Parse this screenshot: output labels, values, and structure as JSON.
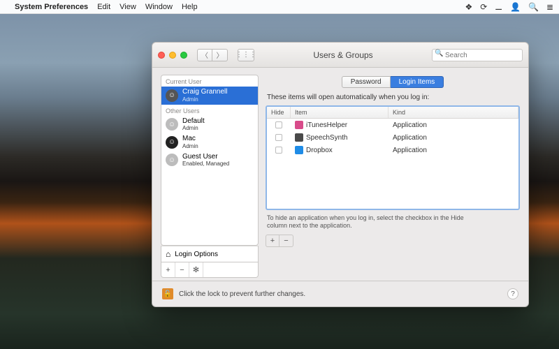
{
  "menubar": {
    "app": "System Preferences",
    "items": [
      "Edit",
      "View",
      "Window",
      "Help"
    ]
  },
  "window": {
    "title": "Users & Groups",
    "search_placeholder": "Search"
  },
  "sidebar": {
    "current_header": "Current User",
    "other_header": "Other Users",
    "current": {
      "name": "Craig Grannell",
      "role": "Admin"
    },
    "others": [
      {
        "name": "Default",
        "role": "Admin"
      },
      {
        "name": "Mac",
        "role": "Admin"
      },
      {
        "name": "Guest User",
        "role": "Enabled, Managed"
      }
    ],
    "login_options": "Login Options"
  },
  "tabs": {
    "password": "Password",
    "login_items": "Login Items"
  },
  "login_items": {
    "description": "These items will open automatically when you log in:",
    "columns": {
      "hide": "Hide",
      "item": "Item",
      "kind": "Kind"
    },
    "rows": [
      {
        "item": "iTunesHelper",
        "kind": "Application",
        "icon_color": "#d84b8a"
      },
      {
        "item": "SpeechSynth",
        "kind": "Application",
        "icon_color": "#4a4a4a"
      },
      {
        "item": "Dropbox",
        "kind": "Application",
        "icon_color": "#1f8ce6"
      }
    ],
    "hint": "To hide an application when you log in, select the checkbox in the Hide column next to the application."
  },
  "lock_text": "Click the lock to prevent further changes."
}
